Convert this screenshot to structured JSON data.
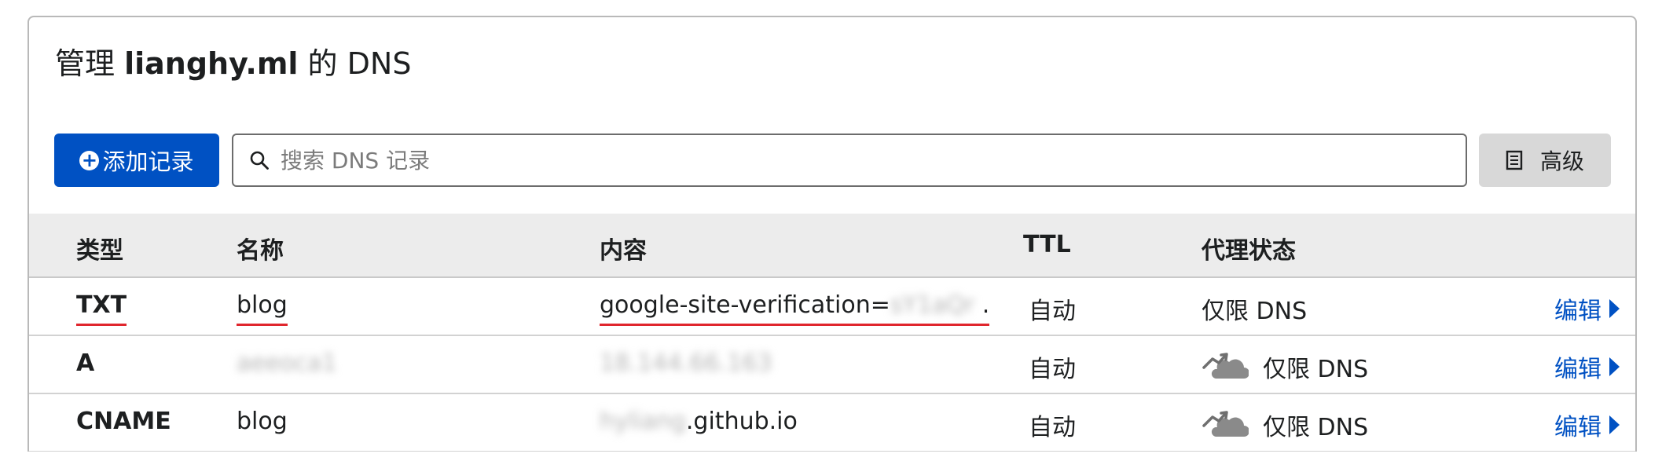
{
  "header": {
    "title_prefix": "管理",
    "domain": "lianghy.ml",
    "title_suffix": "的 DNS"
  },
  "toolbar": {
    "add_label": "添加记录",
    "search_placeholder": "搜索 DNS 记录",
    "advanced_label": "高级"
  },
  "table": {
    "columns": [
      "类型",
      "名称",
      "内容",
      "TTL",
      "代理状态"
    ],
    "rows": [
      {
        "type": "TXT",
        "name": "blog",
        "content": "google-site-verification=",
        "content_blurred": "sY1aQr",
        "ttl": "自动",
        "proxy": "仅限 DNS",
        "edit": "编辑"
      },
      {
        "type": "A",
        "name_blurred": "aeeoca1",
        "content_blurred": "18.144.66.163",
        "ttl": "自动",
        "proxy": "仅限 DNS",
        "edit": "编辑"
      },
      {
        "type": "CNAME",
        "name": "blog",
        "content_blurred": "hyliang",
        "content_tail": ".github.io",
        "ttl": "自动",
        "proxy": "仅限 DNS",
        "edit": "编辑"
      }
    ]
  },
  "icons": {
    "add": "plus-circle-icon",
    "search": "search-icon",
    "advanced": "document-icon",
    "proxy": "dns-only-cloud-icon",
    "edit": "caret-right-icon"
  },
  "colors": {
    "primary": "#0051c3",
    "annotation": "#e0262d",
    "header_bg": "#ececec"
  }
}
